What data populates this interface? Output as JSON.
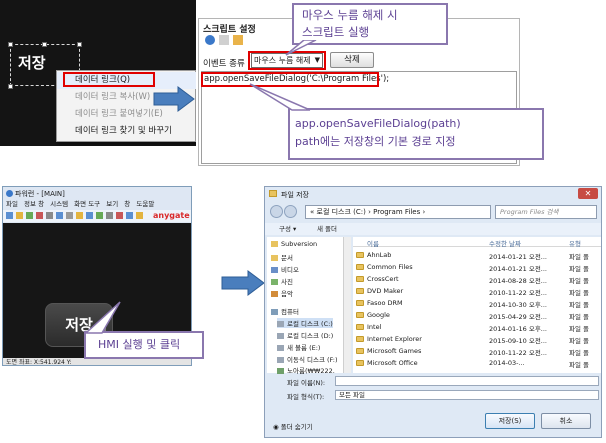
{
  "top_left": {
    "object_label": "저장",
    "context_menu": [
      {
        "label": "데이터 링크(Q)",
        "enabled": true
      },
      {
        "label": "데이터 링크 복사(W)",
        "enabled": false
      },
      {
        "label": "데이터 링크 붙여넣기(E)",
        "enabled": false
      },
      {
        "label": "데이터 링크 찾기 및 바꾸기",
        "enabled": true
      }
    ]
  },
  "script_window": {
    "title": "스크립트 설정",
    "event_label": "이벤트 종류 :",
    "event_value": "마우스 누름 해제",
    "delete_button": "삭제",
    "code_line": "app.openSaveFileDialog('C:\\Program Files');"
  },
  "callouts": {
    "c1_line1": "마우스 누름 해제 시",
    "c1_line2": "스크립트 실행",
    "c2_line1": "app.openSaveFileDialog(path)",
    "c2_line2": "path에는 저장창의 기본 경로 지정",
    "c3": "HMI 실행 및 클릭"
  },
  "hmi_window": {
    "title": "파워런 - [MAIN]",
    "menu": [
      "파일",
      "정보 창",
      "시스템",
      "화면 도구",
      "보기",
      "창",
      "도움말"
    ],
    "brand": "anygate",
    "button_label": "저장",
    "status": "도면 좌표: X:541.924 Y:"
  },
  "save_dialog": {
    "title": "파일 저장",
    "address": "« 로컬 디스크 (C:) › Program Files ›",
    "search_placeholder": "Program Files 검색",
    "cmd_organize": "구성 ▾",
    "cmd_new_folder": "새 폴더",
    "nav_items": [
      "Subversion",
      "문서",
      "비디오",
      "사진",
      "음악",
      "컴퓨터",
      "로컬 디스크 (C:)",
      "로컬 디스크 (D:)",
      "새 볼륨 (E:)",
      "이동식 디스크 (F:)",
      "노아룸(₩₩222."
    ],
    "columns": {
      "name": "이름",
      "date": "수정한 날짜",
      "type": "유형"
    },
    "files": [
      {
        "name": "AhnLab",
        "date": "2014-01-21 오전...",
        "type": "파일 폴"
      },
      {
        "name": "Common Files",
        "date": "2014-01-21 오전...",
        "type": "파일 폴"
      },
      {
        "name": "CrossCert",
        "date": "2014-08-28 오전...",
        "type": "파일 폴"
      },
      {
        "name": "DVD Maker",
        "date": "2010-11-22 오전...",
        "type": "파일 폴"
      },
      {
        "name": "Fasoo DRM",
        "date": "2014-10-30 오후...",
        "type": "파일 폴"
      },
      {
        "name": "Google",
        "date": "2015-04-29 오전...",
        "type": "파일 폴"
      },
      {
        "name": "Intel",
        "date": "2014-01-16 오후...",
        "type": "파일 폴"
      },
      {
        "name": "Internet Explorer",
        "date": "2015-09-10 오전...",
        "type": "파일 폴"
      },
      {
        "name": "Microsoft Games",
        "date": "2010-11-22 오전...",
        "type": "파일 폴"
      },
      {
        "name": "Microsoft Office",
        "date": "2014-03-...",
        "type": "파일 폴"
      }
    ],
    "filename_label": "파일 이름(N):",
    "filetype_label": "파일 형식(T):",
    "filetype_value": "모든 파일",
    "hide_folders": "◉ 폴더 숨기기",
    "save_button": "저장(S)",
    "cancel_button": "취소"
  },
  "colors": {
    "accent_red": "#e00000",
    "callout_border": "#8a77ae",
    "callout_text": "#5b3f92",
    "arrow": "#4a7ebd"
  }
}
